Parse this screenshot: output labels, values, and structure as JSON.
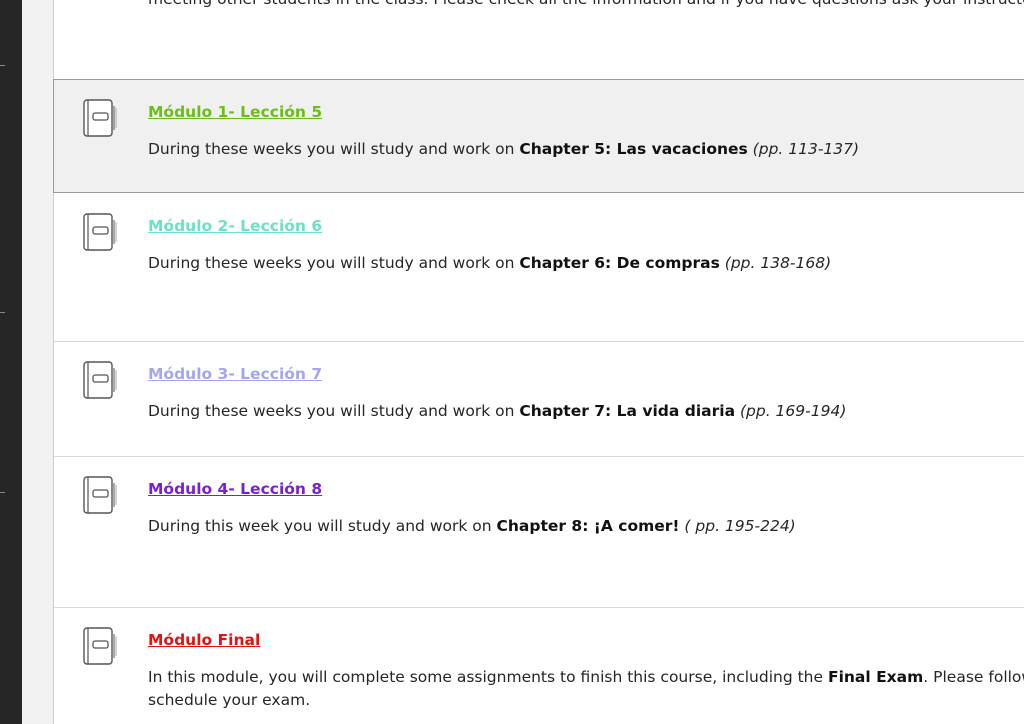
{
  "intro": {
    "text": "meeting other students in the class. Please check all the information and if you have questions ask your instructor"
  },
  "items": [
    {
      "title": "Módulo 1- Lección 5",
      "color": "#6abf16",
      "prefix": "During these weeks you will study and work on ",
      "bold": "Chapter 5: Las vacaciones",
      "pages": " (pp. 113-137)",
      "icon": "book-icon"
    },
    {
      "title": "Módulo 2- Lección 6",
      "color": "#6ee0c7",
      "prefix": "During these weeks you will study and work on ",
      "bold": "Chapter 6: De compras",
      "pages": " (pp. 138-168)",
      "icon": "book-icon"
    },
    {
      "title": "Módulo 3- Lección 7",
      "color": "#a6a6f0",
      "prefix": "During these weeks you will study and work on ",
      "bold": "Chapter 7: La vida diaria",
      "pages": " (pp. 169-194)",
      "icon": "book-icon"
    },
    {
      "title": "Módulo 4- Lección 8",
      "color": "#7b1fd6",
      "prefix": "During this week you will study and work on ",
      "bold": "Chapter 8: ¡A comer!",
      "pages": " ( pp. 195-224)",
      "icon": "book-icon"
    },
    {
      "title": "Módulo Final",
      "color": "#e01414",
      "prefix": "In this module, you will complete some assignments to finish this course, including the ",
      "bold": "Final Exam",
      "suffix": ". Please follow",
      "line2": "schedule your exam.",
      "icon": "book-icon"
    }
  ]
}
